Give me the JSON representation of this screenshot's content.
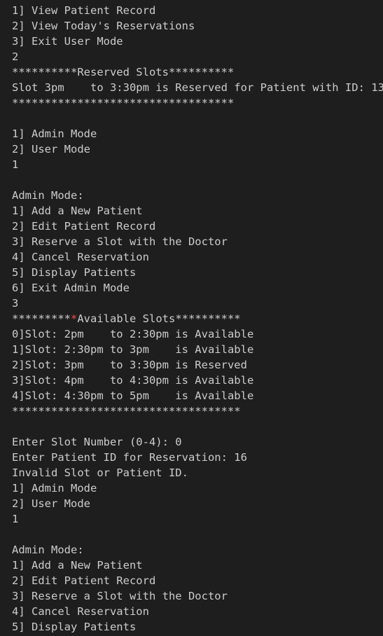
{
  "terminal": {
    "lines": [
      "1] View Patient Record",
      "2] View Today's Reservations",
      "3] Exit User Mode",
      "2",
      "**********Reserved Slots**********",
      "Slot 3pm    to 3:30pm is Reserved for Patient with ID: 13",
      "**********************************",
      "",
      "1] Admin Mode",
      "2] User Mode",
      "1",
      "",
      "Admin Mode:",
      "1] Add a New Patient",
      "2] Edit Patient Record",
      "3] Reserve a Slot with the Doctor",
      "4] Cancel Reservation",
      "5] Display Patients",
      "6] Exit Admin Mode",
      "3",
      "**********Available Slots**********",
      "0]Slot: 2pm    to 2:30pm is Available",
      "1]Slot: 2:30pm to 3pm    is Available",
      "2]Slot: 3pm    to 3:30pm is Reserved",
      "3]Slot: 4pm    to 4:30pm is Available",
      "4]Slot: 4:30pm to 5pm    is Available",
      "***********************************",
      "",
      "Enter Slot Number (0-4): 0",
      "Enter Patient ID for Reservation: 16",
      "Invalid Slot or Patient ID.",
      "1] Admin Mode",
      "2] User Mode",
      "1",
      "",
      "Admin Mode:",
      "1] Add a New Patient",
      "2] Edit Patient Record",
      "3] Reserve a Slot with the Doctor",
      "4] Cancel Reservation",
      "5] Display Patients"
    ],
    "colors": {
      "background": "#1e1e1e",
      "text": "#cccccc",
      "highlight_star": "#f14c4c"
    }
  }
}
